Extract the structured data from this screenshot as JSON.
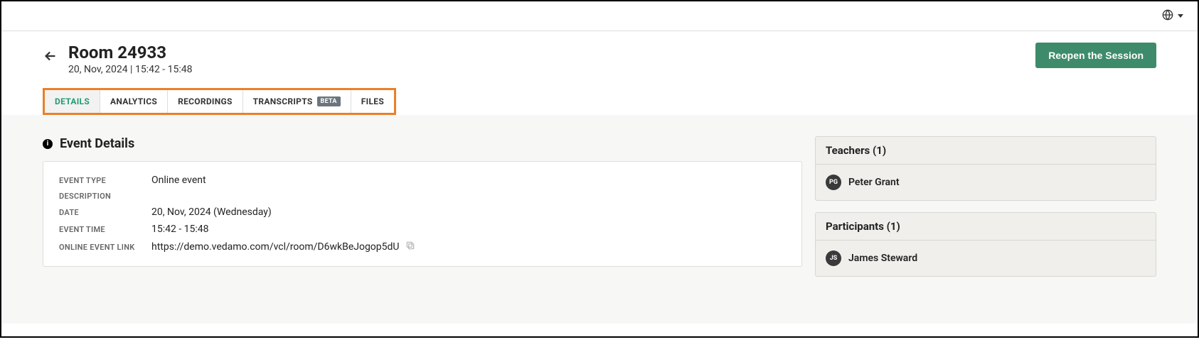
{
  "header": {
    "title": "Room 24933",
    "subtitle": "20, Nov, 2024 | 15:42 - 15:48",
    "reopen_label": "Reopen the Session"
  },
  "tabs": {
    "details": "DETAILS",
    "analytics": "ANALYTICS",
    "recordings": "RECORDINGS",
    "transcripts": "TRANSCRIPTS",
    "transcripts_badge": "BETA",
    "files": "FILES"
  },
  "section": {
    "title": "Event Details"
  },
  "details": {
    "labels": {
      "event_type": "EVENT TYPE",
      "description": "DESCRIPTION",
      "date": "DATE",
      "event_time": "EVENT TIME",
      "link": "ONLINE EVENT LINK"
    },
    "values": {
      "event_type": "Online event",
      "description": "",
      "date": "20, Nov, 2024 (Wednesday)",
      "event_time": "15:42 - 15:48",
      "link": "https://demo.vedamo.com/vcl/room/D6wkBeJogop5dU"
    }
  },
  "teachers": {
    "header": "Teachers (1)",
    "items": [
      {
        "initials": "PG",
        "name": "Peter Grant"
      }
    ]
  },
  "participants": {
    "header": "Participants (1)",
    "items": [
      {
        "initials": "JS",
        "name": "James Steward"
      }
    ]
  }
}
